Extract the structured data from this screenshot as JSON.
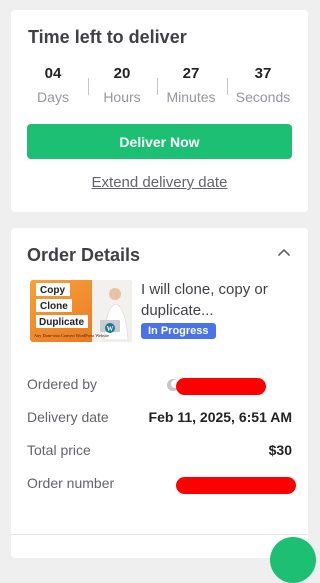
{
  "delivery": {
    "title": "Time left to deliver",
    "countdown": [
      {
        "value": "04",
        "unit": "Days"
      },
      {
        "value": "20",
        "unit": "Hours"
      },
      {
        "value": "27",
        "unit": "Minutes"
      },
      {
        "value": "37",
        "unit": "Seconds"
      }
    ],
    "deliver_button": "Deliver Now",
    "extend_link": "Extend delivery date",
    "accent_color": "#1dbf73"
  },
  "order": {
    "title": "Order Details",
    "collapse_icon": "chevron-up-icon",
    "gig": {
      "title": "I will clone, copy or duplicate...",
      "status": "In Progress",
      "status_color": "#4a73e8",
      "thumbnail_words": [
        "Copy",
        "Clone",
        "Duplicate"
      ],
      "thumbnail_caption": "Any Done-into Convert WordPress Website"
    },
    "rows": {
      "ordered_by_label": "Ordered by",
      "delivery_date_label": "Delivery date",
      "delivery_date_value": "Feb 11, 2025, 6:51 AM",
      "total_price_label": "Total price",
      "total_price_value": "$30",
      "order_number_label": "Order number"
    }
  }
}
